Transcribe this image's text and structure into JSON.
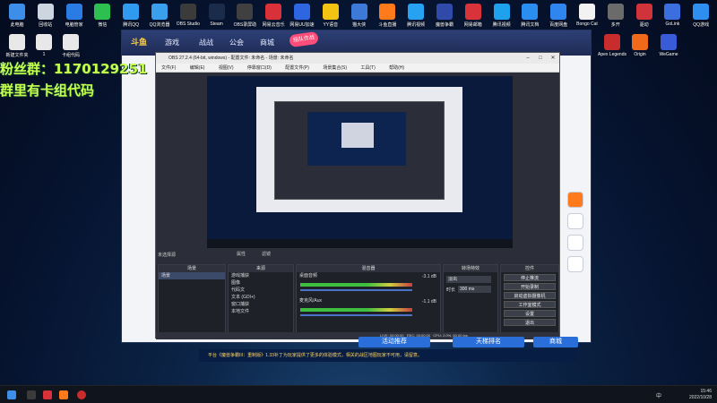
{
  "desktop": {
    "top_icons": [
      {
        "label": "此电脑",
        "color": "#3d8ee8"
      },
      {
        "label": "回收站",
        "color": "#cdd6e0"
      },
      {
        "label": "电脑管家",
        "color": "#2a7be4"
      },
      {
        "label": "微信",
        "color": "#2dbf4f"
      },
      {
        "label": "腾讯QQ",
        "color": "#2f9af0"
      },
      {
        "label": "QQ浏览器",
        "color": "#3aa0ee"
      },
      {
        "label": "OBS Studio",
        "color": "#3b3b3b"
      },
      {
        "label": "Steam",
        "color": "#1b2c4a"
      },
      {
        "label": "OBS录屏助",
        "color": "#404040"
      },
      {
        "label": "网易云音乐",
        "color": "#d9313a"
      },
      {
        "label": "网易UU加速",
        "color": "#2e65e0"
      },
      {
        "label": "YY语音",
        "color": "#f2c313"
      },
      {
        "label": "猫大侠",
        "color": "#3d7ad8"
      },
      {
        "label": "斗鱼直播",
        "color": "#ff7a1a"
      },
      {
        "label": "腾讯视频",
        "color": "#27a1f1"
      },
      {
        "label": "魔兽争霸",
        "color": "#2f4aa8"
      },
      {
        "label": "网易邮箱",
        "color": "#d8323a"
      },
      {
        "label": "腾讯视频",
        "color": "#1ea2ee"
      },
      {
        "label": "腾讯文档",
        "color": "#2a8ef0"
      },
      {
        "label": "百度网盘",
        "color": "#2f86f0"
      },
      {
        "label": "Bongo Cat",
        "color": "#f2f2f2"
      },
      {
        "label": "多开",
        "color": "#6b6b6b"
      },
      {
        "label": "驱动",
        "color": "#d0343a"
      },
      {
        "label": "GoLink",
        "color": "#3b6fe0"
      },
      {
        "label": "QQ游戏",
        "color": "#2f8ff0"
      }
    ],
    "left_icons": [
      {
        "label": "新建文件夹",
        "color": "#e8e8e8"
      },
      {
        "label": "1",
        "color": "#e8e8e8"
      },
      {
        "label": "卡组代码",
        "color": "#e8e8e8"
      }
    ],
    "right_icons": [
      {
        "label": "Apex Legends",
        "color": "#c92c2c"
      },
      {
        "label": "Origin",
        "color": "#f06a1a"
      },
      {
        "label": "WeGame",
        "color": "#3a5bd8"
      }
    ],
    "overlay_text": [
      "粉丝群：1170129251",
      "群里有卡组代码"
    ]
  },
  "game_client": {
    "logo": "斗鱼",
    "nav": [
      "游戏",
      "战战",
      "公会",
      "商城"
    ],
    "badge": "组队作战",
    "bottom_buttons": [
      "活动推荐",
      "天梯排名",
      "商城"
    ],
    "side_icons": [
      "play-icon",
      "home-icon",
      "grid-icon",
      "support-icon"
    ]
  },
  "obs": {
    "title": "OBS 27.2.4 (64-bit, windows) - 配置文件: 未命名 - 场景: 未命名",
    "menu": [
      "文件(F)",
      "编辑(E)",
      "视图(V)",
      "停靠窗口(D)",
      "配置文件(P)",
      "场景集合(S)",
      "工具(T)",
      "帮助(H)"
    ],
    "no_source_label": "未选择源",
    "props_btn": "属性",
    "filters_btn": "滤镜",
    "docks": {
      "scenes": {
        "title": "场景",
        "items": [
          "场景"
        ]
      },
      "sources": {
        "title": "来源",
        "items": [
          "游戏捕获",
          "图像",
          "代码文",
          "文本 (GDI+)",
          "窗口捕获",
          "本地文件"
        ]
      },
      "mixer": {
        "title": "混音器",
        "tracks": [
          {
            "name": "桌面音频",
            "db": "-3.1 dB"
          },
          {
            "name": "麦克风/Aux",
            "db": "-1.1 dB"
          }
        ]
      },
      "transitions": {
        "title": "转场特效",
        "type": "淡出",
        "duration_label": "时长",
        "duration": "300 ms"
      },
      "controls": {
        "title": "控件",
        "buttons": [
          "停止推流",
          "开始录制",
          "启动虚拟摄像机",
          "工作室模式",
          "设置",
          "退出"
        ]
      }
    },
    "status": {
      "live": "LIVE: 00:00:00",
      "rec": "REC: 00:00:00",
      "cpu": "CPU: 2.0%, 60.00 fps"
    }
  },
  "notification": "平台《魔兽争霸III：重制版》1.33补丁为玩家提供了更多的体验模式，相关的战区地图玩家不可用，请留意。",
  "taskbar": {
    "time": "15:46",
    "date": "2022/10/28",
    "tray_lang": "中"
  },
  "colors": {
    "overlay_text": "#c9ff4f",
    "client_nav": "#2d3f75",
    "notification_bg": "#071d44"
  }
}
